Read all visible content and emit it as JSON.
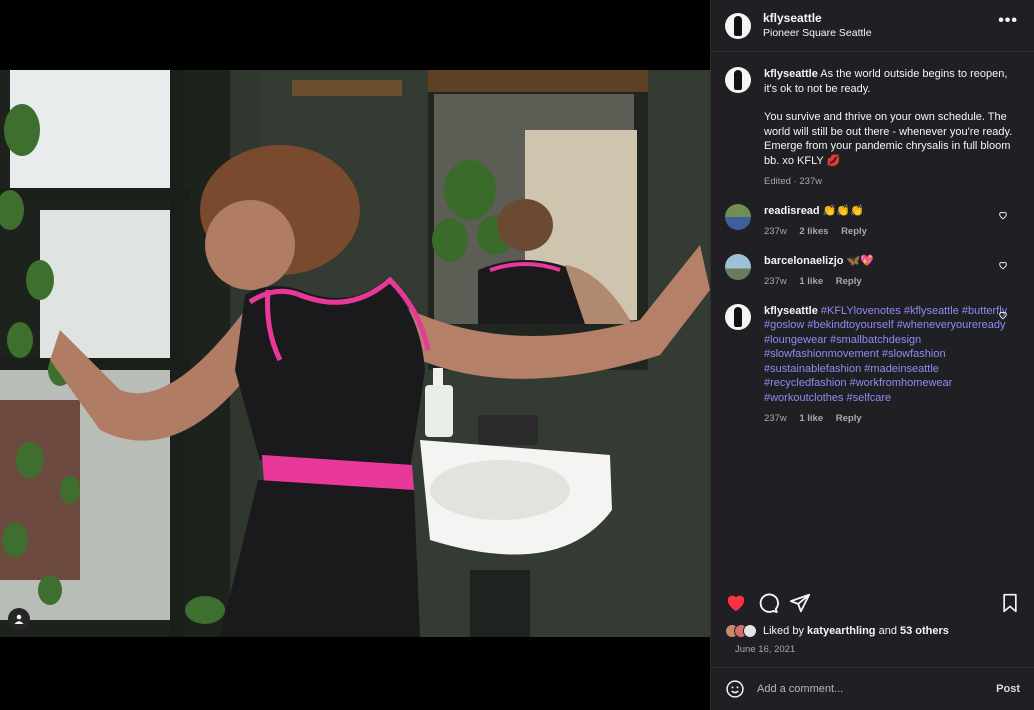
{
  "post": {
    "username": "kflyseattle",
    "location": "Pioneer Square Seattle",
    "more_label": "•••",
    "caption": {
      "username": "kflyseattle",
      "line1": "As the world outside begins to reopen, it's ok to not be ready.",
      "line2": "You survive and thrive on your own schedule. The world will still be out there - whenever you're ready. Emerge from your pandemic chrysalis in full bloom bb. xo KFLY 💋",
      "meta": "Edited · 237w"
    },
    "comments": [
      {
        "username": "readisread",
        "text": "👏👏👏",
        "time": "237w",
        "likes": "2 likes",
        "reply": "Reply"
      },
      {
        "username": "barcelonaelizjo",
        "text": "🦋💖",
        "time": "237w",
        "likes": "1 like",
        "reply": "Reply"
      },
      {
        "username": "kflyseattle",
        "text": "#KFLYlovenotes #kflyseattle #butterfly #goslow #bekindtoyourself #wheneveryoureready #loungewear #smallbatchdesign #slowfashionmovement #slowfashion #sustainablefashion #madeinseattle #recycledfashion #workfromhomewear #workoutclothes #selfcare",
        "time": "237w",
        "likes": "1 like",
        "reply": "Reply"
      }
    ],
    "liked_by_prefix": "Liked by",
    "liked_by_user": "katyearthling",
    "liked_by_and": "and",
    "liked_by_others": "53 others",
    "date": "June 16, 2021",
    "comment_placeholder": "Add a comment...",
    "post_label": "Post"
  },
  "colors": {
    "like_red": "#ff3040",
    "hashtag": "#8c8cf2",
    "panel_bg": "#202024",
    "tank_black": "#1a1a1c",
    "trim_pink": "#e8399a"
  },
  "icons": [
    "user-tag-icon",
    "heart-filled-icon",
    "comment-icon",
    "share-icon",
    "bookmark-icon",
    "emoji-icon",
    "heart-outline-icon",
    "more-icon"
  ]
}
